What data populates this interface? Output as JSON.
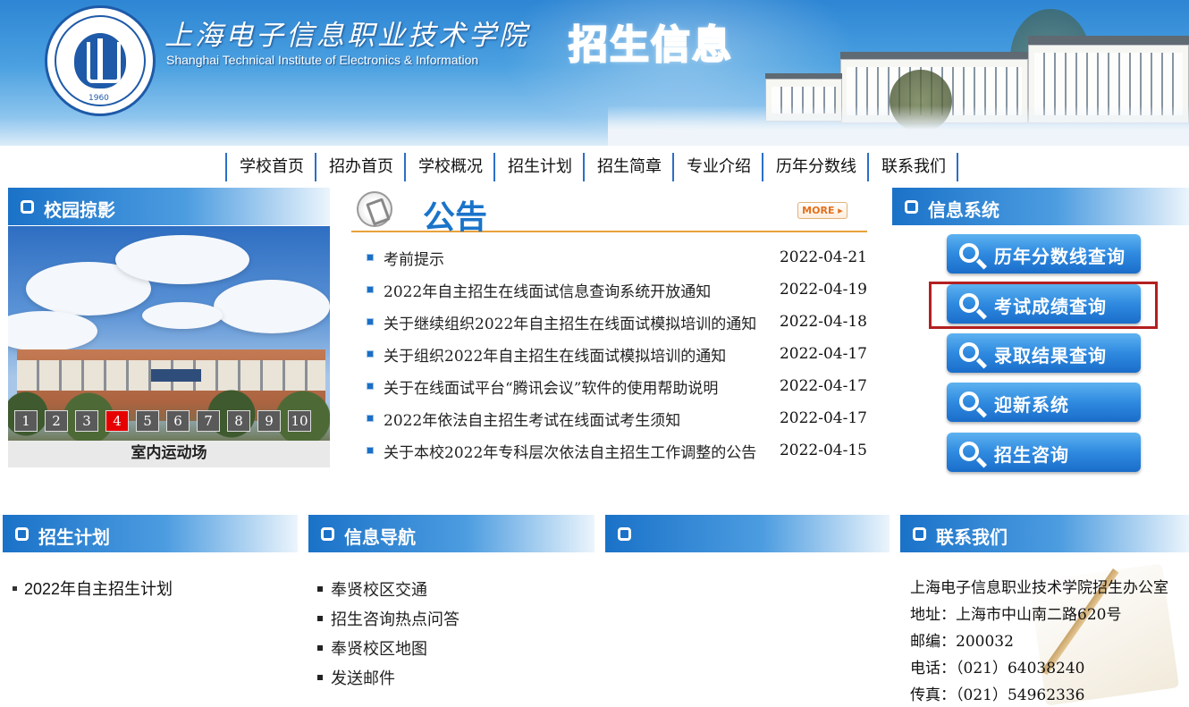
{
  "header": {
    "school_name_cn": "上海电子信息职业技术学院",
    "school_name_en": "Shanghai Technical Institute of Electronics & Information",
    "logo_year": "1960",
    "banner_title": "招生信息"
  },
  "nav": {
    "items": [
      "学校首页",
      "招办首页",
      "学校概况",
      "招生计划",
      "招生简章",
      "专业介绍",
      "历年分数线",
      "联系我们"
    ]
  },
  "campus": {
    "title": "校园掠影",
    "slides": [
      "1",
      "2",
      "3",
      "4",
      "5",
      "6",
      "7",
      "8",
      "9",
      "10"
    ],
    "active_slide": "4",
    "caption": "室内运动场"
  },
  "announcements": {
    "title": "公告",
    "more_label": "MORE ▸",
    "items": [
      {
        "title": "考前提示",
        "date": "2022-04-21"
      },
      {
        "title": "2022年自主招生在线面试信息查询系统开放通知",
        "date": "2022-04-19"
      },
      {
        "title": "关于继续组织2022年自主招生在线面试模拟培训的通知",
        "date": "2022-04-18"
      },
      {
        "title": "关于组织2022年自主招生在线面试模拟培训的通知",
        "date": "2022-04-17"
      },
      {
        "title": "关于在线面试平台“腾讯会议”软件的使用帮助说明",
        "date": "2022-04-17"
      },
      {
        "title": "2022年依法自主招生考试在线面试考生须知",
        "date": "2022-04-17"
      },
      {
        "title": "关于本校2022年专科层次依法自主招生工作调整的公告",
        "date": "2022-04-15"
      }
    ]
  },
  "info_system": {
    "title": "信息系统",
    "buttons": [
      "历年分数线查询",
      "考试成绩查询",
      "录取结果查询",
      "迎新系统",
      "招生咨询"
    ],
    "highlighted": "考试成绩查询"
  },
  "plan": {
    "title": "招生计划",
    "items": [
      "2022年自主招生计划"
    ]
  },
  "info_nav": {
    "title": "信息导航",
    "items": [
      "奉贤校区交通",
      "招生咨询热点问答",
      "奉贤校区地图",
      "发送邮件"
    ]
  },
  "empty_section": {
    "title": ""
  },
  "contact": {
    "title": "联系我们",
    "lines": [
      "上海电子信息职业技术学院招生办公室",
      "地址：上海市中山南二路620号",
      "邮编：200032",
      "电话：（021）64038240",
      "传真：（021）54962336"
    ]
  },
  "colors": {
    "accent_blue": "#1a72c8",
    "nav_divider": "#2b6fc8",
    "active_slide": "#e60000",
    "highlight_box": "#b32020",
    "announcement_rule": "#e8a13c"
  }
}
